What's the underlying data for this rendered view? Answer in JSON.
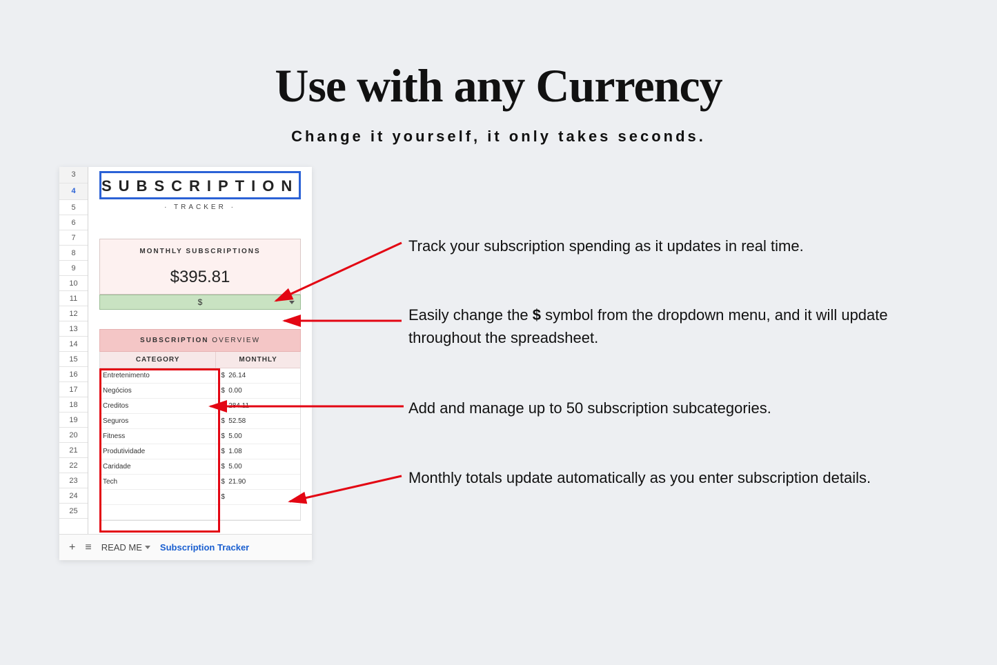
{
  "headline": "Use with any Currency",
  "subhead": "Change it yourself, it only takes seconds.",
  "sheet": {
    "row_start": 3,
    "row_count": 23,
    "title_main": "SUBSCRIPTION",
    "title_sub": "· TRACKER ·",
    "monthly_label": "MONTHLY SUBSCRIPTIONS",
    "monthly_amount": "$395.81",
    "currency_selected": "$",
    "overview_bold": "SUBSCRIPTION",
    "overview_rest": " OVERVIEW",
    "col_category": "CATEGORY",
    "col_monthly": "MONTHLY",
    "rows": [
      {
        "cat": "Entretenimento",
        "sym": "$",
        "val": "26.14"
      },
      {
        "cat": "Negócios",
        "sym": "$",
        "val": "0.00"
      },
      {
        "cat": "Creditos",
        "sym": "$",
        "val": "284.11"
      },
      {
        "cat": "Seguros",
        "sym": "$",
        "val": "52.58"
      },
      {
        "cat": "Fitness",
        "sym": "$",
        "val": "5.00"
      },
      {
        "cat": "Produtividade",
        "sym": "$",
        "val": "1.08"
      },
      {
        "cat": "Caridade",
        "sym": "$",
        "val": "5.00"
      },
      {
        "cat": "Tech",
        "sym": "$",
        "val": "21.90"
      },
      {
        "cat": "",
        "sym": "$",
        "val": ""
      },
      {
        "cat": "",
        "sym": "",
        "val": ""
      }
    ],
    "tab_readme": "READ ME",
    "tab_tracker": "Subscription Tracker"
  },
  "callouts": {
    "c1": "Track your subscription spending as it updates in real time.",
    "c2a": "Easily change the ",
    "c2b": "$",
    "c2c": " symbol from the dropdown menu, and it will update throughout the spreadsheet.",
    "c3": "Add and manage up to 50 subscription subcategories.",
    "c4": "Monthly totals update automatically as you enter subscription details."
  }
}
